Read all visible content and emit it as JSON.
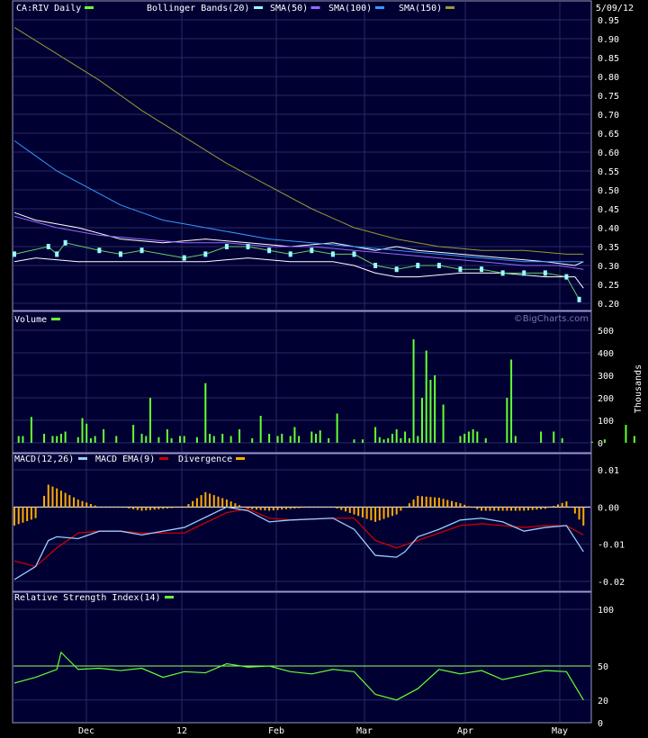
{
  "colors": {
    "background": "#000033",
    "grid": "#2a2a66",
    "frame": "#9999cc",
    "price": "#99ffff",
    "bollinger": "#ffffff",
    "sma50": "#9966ff",
    "sma100": "#3399ff",
    "sma150": "#999933",
    "volume": "#66ff33",
    "macd": "#99ccff",
    "macd_ema": "#cc0000",
    "divergence": "#ffaa00",
    "rsi": "#66ff33",
    "rsi_ref": "#99ff66"
  },
  "header": {
    "date": "5/09/12"
  },
  "watermark": "©BigCharts.com",
  "x_axis": {
    "labels": [
      "Dec",
      "12",
      "Feb",
      "Mar",
      "Apr",
      "May"
    ],
    "sessions": 135
  },
  "chart_data": [
    {
      "id": "price",
      "type": "line",
      "title": "CA:RIV Daily",
      "legend": [
        "Bollinger Bands(20)",
        "SMA(50)",
        "SMA(100)",
        "SMA(150)"
      ],
      "ylim": [
        0.2,
        0.95
      ],
      "yticks": [
        "0.95",
        "0.90",
        "0.85",
        "0.80",
        "0.75",
        "0.70",
        "0.65",
        "0.60",
        "0.55",
        "0.50",
        "0.45",
        "0.40",
        "0.35",
        "0.30",
        "0.25",
        "0.20"
      ],
      "series": [
        {
          "name": "CA:RIV Daily",
          "x": [
            0,
            8,
            10,
            12,
            20,
            25,
            30,
            40,
            45,
            50,
            55,
            60,
            65,
            70,
            75,
            80,
            85,
            90,
            95,
            100,
            105,
            110,
            115,
            120,
            125,
            130,
            133
          ],
          "values": [
            0.33,
            0.35,
            0.33,
            0.36,
            0.34,
            0.33,
            0.34,
            0.32,
            0.33,
            0.35,
            0.35,
            0.34,
            0.33,
            0.34,
            0.33,
            0.33,
            0.3,
            0.29,
            0.3,
            0.3,
            0.29,
            0.29,
            0.28,
            0.28,
            0.28,
            0.27,
            0.21
          ]
        },
        {
          "name": "Bollinger Bands(20)",
          "x": [
            0,
            5,
            15,
            25,
            35,
            45,
            55,
            65,
            75,
            80,
            85,
            90,
            95,
            105,
            115,
            125,
            132,
            134
          ],
          "values": [
            0.44,
            0.42,
            0.4,
            0.37,
            0.36,
            0.37,
            0.36,
            0.35,
            0.36,
            0.35,
            0.34,
            0.35,
            0.34,
            0.33,
            0.32,
            0.31,
            0.3,
            0.31
          ]
        },
        {
          "name": "Bollinger Bands(20)",
          "x": [
            0,
            5,
            15,
            25,
            35,
            45,
            55,
            65,
            75,
            80,
            85,
            90,
            95,
            105,
            115,
            125,
            132,
            134
          ],
          "values": [
            0.31,
            0.32,
            0.31,
            0.31,
            0.31,
            0.31,
            0.32,
            0.31,
            0.31,
            0.3,
            0.28,
            0.27,
            0.27,
            0.28,
            0.28,
            0.27,
            0.27,
            0.24
          ]
        },
        {
          "name": "SMA(50)",
          "x": [
            0,
            10,
            20,
            30,
            40,
            50,
            60,
            70,
            80,
            90,
            100,
            110,
            120,
            128,
            134
          ],
          "values": [
            0.43,
            0.4,
            0.38,
            0.37,
            0.36,
            0.36,
            0.35,
            0.35,
            0.34,
            0.33,
            0.32,
            0.31,
            0.3,
            0.3,
            0.29
          ]
        },
        {
          "name": "SMA(100)",
          "x": [
            0,
            5,
            10,
            15,
            20,
            25,
            30,
            35,
            40,
            50,
            60,
            70,
            80,
            90,
            100,
            110,
            120,
            130,
            134
          ],
          "values": [
            0.63,
            0.59,
            0.55,
            0.52,
            0.49,
            0.46,
            0.44,
            0.42,
            0.41,
            0.39,
            0.37,
            0.36,
            0.35,
            0.34,
            0.33,
            0.32,
            0.31,
            0.31,
            0.31
          ]
        },
        {
          "name": "SMA(150)",
          "x": [
            0,
            10,
            20,
            30,
            40,
            50,
            60,
            70,
            80,
            90,
            100,
            110,
            120,
            130,
            134
          ],
          "values": [
            0.93,
            0.86,
            0.79,
            0.71,
            0.64,
            0.57,
            0.51,
            0.45,
            0.4,
            0.37,
            0.35,
            0.34,
            0.34,
            0.33,
            0.33
          ]
        }
      ]
    },
    {
      "id": "volume",
      "type": "bar",
      "title": "Volume",
      "ylabel": "Thousands",
      "ylim": [
        0,
        500
      ],
      "yticks": [
        "500",
        "400",
        "300",
        "200",
        "100",
        "0"
      ],
      "series": [
        {
          "name": "Volume",
          "x": [
            1,
            2,
            4,
            7,
            9,
            10,
            11,
            12,
            15,
            16,
            17,
            18,
            19,
            21,
            24,
            28,
            30,
            31,
            32,
            34,
            36,
            37,
            39,
            40,
            43,
            45,
            46,
            47,
            49,
            51,
            53,
            56,
            58,
            60,
            62,
            63,
            65,
            66,
            67,
            70,
            71,
            72,
            74,
            76,
            80,
            82,
            85,
            86,
            87,
            88,
            89,
            90,
            91,
            92,
            93,
            94,
            95,
            96,
            97,
            98,
            99,
            101,
            105,
            106,
            107,
            108,
            109,
            111,
            116,
            117,
            118,
            124,
            127,
            129,
            136,
            139,
            144,
            146
          ],
          "values": [
            30,
            30,
            115,
            40,
            30,
            30,
            40,
            50,
            25,
            110,
            85,
            20,
            30,
            60,
            30,
            80,
            40,
            30,
            200,
            25,
            60,
            20,
            30,
            30,
            25,
            265,
            40,
            30,
            40,
            30,
            60,
            20,
            120,
            40,
            30,
            40,
            30,
            70,
            30,
            50,
            40,
            55,
            20,
            130,
            15,
            15,
            70,
            25,
            15,
            20,
            40,
            60,
            20,
            50,
            20,
            460,
            30,
            200,
            410,
            280,
            300,
            170,
            30,
            40,
            50,
            60,
            50,
            20,
            200,
            370,
            30,
            50,
            50,
            20,
            5,
            15,
            80,
            30
          ]
        }
      ]
    },
    {
      "id": "macd",
      "type": "line",
      "title": "MACD(12,26)",
      "legend": [
        "MACD EMA(9)",
        "Divergence"
      ],
      "ylim": [
        -0.02,
        0.01
      ],
      "yticks": [
        "0.01",
        "0.00",
        "-0.01",
        "-0.02"
      ],
      "series": [
        {
          "name": "MACD(12,26)",
          "x": [
            0,
            5,
            8,
            10,
            15,
            20,
            25,
            30,
            40,
            50,
            55,
            60,
            65,
            75,
            80,
            85,
            90,
            92,
            95,
            100,
            105,
            110,
            115,
            120,
            125,
            130,
            134
          ],
          "values": [
            -0.0195,
            -0.016,
            -0.009,
            -0.008,
            -0.0085,
            -0.0065,
            -0.0065,
            -0.0075,
            -0.0055,
            0,
            -0.001,
            -0.004,
            -0.0035,
            -0.003,
            -0.006,
            -0.013,
            -0.0135,
            -0.012,
            -0.008,
            -0.006,
            -0.0035,
            -0.003,
            -0.004,
            -0.0065,
            -0.0055,
            -0.005,
            -0.012
          ]
        },
        {
          "name": "MACD EMA(9)",
          "x": [
            0,
            5,
            10,
            15,
            20,
            25,
            30,
            40,
            50,
            55,
            60,
            65,
            75,
            80,
            85,
            90,
            95,
            100,
            105,
            110,
            115,
            120,
            125,
            130,
            134
          ],
          "values": [
            -0.0145,
            -0.016,
            -0.011,
            -0.007,
            -0.0065,
            -0.0065,
            -0.007,
            -0.007,
            -0.0015,
            -0.0005,
            -0.003,
            -0.0035,
            -0.003,
            -0.003,
            -0.009,
            -0.011,
            -0.009,
            -0.007,
            -0.005,
            -0.0045,
            -0.005,
            -0.0055,
            -0.005,
            -0.005,
            -0.0075
          ]
        },
        {
          "name": "Divergence",
          "x": [
            0,
            5,
            8,
            10,
            15,
            20,
            25,
            30,
            40,
            45,
            50,
            55,
            60,
            65,
            70,
            75,
            80,
            85,
            90,
            95,
            100,
            105,
            110,
            115,
            120,
            125,
            130,
            134
          ],
          "values": [
            -0.005,
            -0.003,
            0.006,
            0.005,
            0.002,
            0,
            0,
            -0.001,
            0,
            0.004,
            0.002,
            -0.0005,
            -0.001,
            -0.0005,
            0,
            0,
            -0.002,
            -0.004,
            -0.002,
            0.003,
            0.0025,
            0.001,
            -0.001,
            -0.001,
            -0.001,
            -0.0005,
            0.0015,
            -0.005
          ]
        }
      ]
    },
    {
      "id": "rsi",
      "type": "line",
      "title": "Relative Strength Index(14)",
      "ylim": [
        0,
        100
      ],
      "yticks": [
        "100",
        "50",
        "20",
        "0"
      ],
      "series": [
        {
          "name": "Relative Strength Index(14)",
          "x": [
            0,
            5,
            10,
            11,
            15,
            20,
            25,
            30,
            35,
            40,
            45,
            50,
            55,
            60,
            65,
            70,
            75,
            80,
            85,
            90,
            95,
            100,
            105,
            110,
            115,
            120,
            125,
            130,
            134
          ],
          "values": [
            35,
            40,
            47,
            62,
            47,
            48,
            46,
            48,
            40,
            45,
            44,
            52,
            49,
            50,
            45,
            43,
            47,
            45,
            25,
            20,
            30,
            47,
            43,
            46,
            38,
            42,
            46,
            45,
            20
          ]
        }
      ]
    }
  ]
}
